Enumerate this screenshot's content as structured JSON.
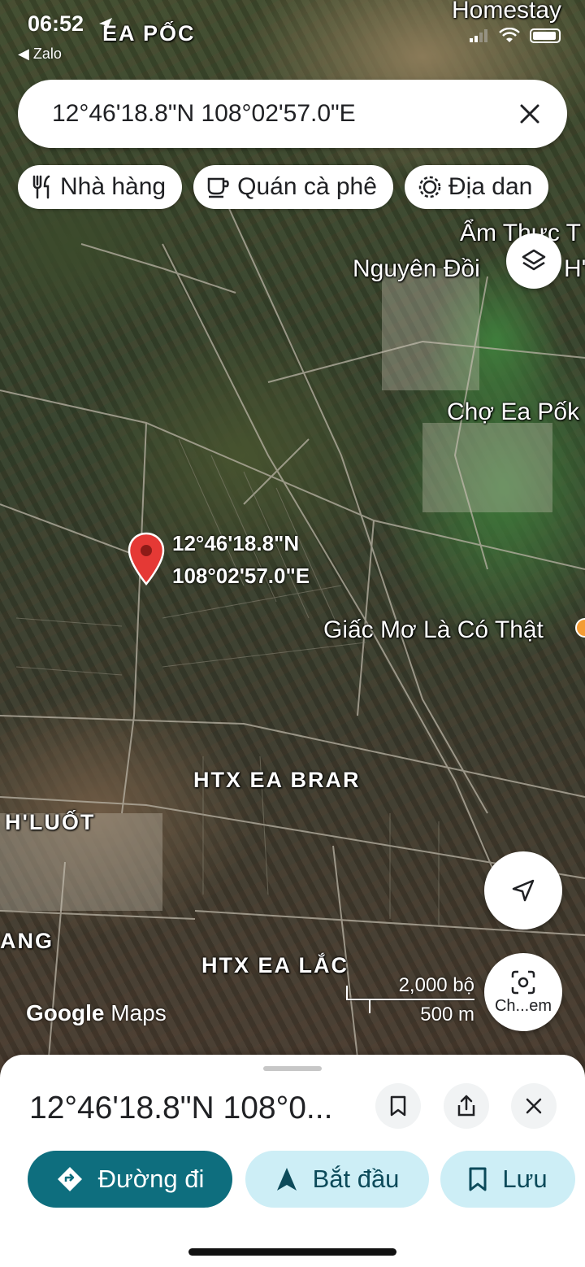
{
  "status_bar": {
    "time": "06:52",
    "back_label": "Zalo"
  },
  "search": {
    "query": "12°46'18.8\"N 108°02'57.0\"E"
  },
  "chips": [
    {
      "label": "Nhà hàng",
      "icon": "restaurant-icon"
    },
    {
      "label": "Quán cà phê",
      "icon": "coffee-icon"
    },
    {
      "label": "Địa dan",
      "icon": "landmark-icon"
    }
  ],
  "map": {
    "labels": {
      "ea_poc": "EA PỐC",
      "homestay": "Homestay",
      "am_thuc": "Ẩm Thực T",
      "nguyen_doi": "Nguyên Đồi",
      "nguyen_doi_tail": "H'la",
      "cho_ea_pok": "Chợ Ea Pốk",
      "giac_mo": "Giấc Mơ Là Có Thật",
      "htx_ea_brar": "HTX EA BRAR",
      "h_luot": "H'LUỐT",
      "ang": "ANG",
      "htx_ea_lac": "HTX EA LẮC"
    },
    "pin_label_line1": "12°46'18.8\"N",
    "pin_label_line2": "108°02'57.0\"E",
    "scale_feet": "2,000 bộ",
    "scale_meters": "500 m",
    "logo_google": "Google",
    "logo_maps": "Maps",
    "photo_search_label": "Ch...em"
  },
  "sheet": {
    "title": "12°46'18.8\"N 108°0...",
    "directions_label": "Đường đi",
    "start_label": "Bắt đầu",
    "save_label": "Lưu"
  },
  "colors": {
    "accent": "#0e6e7e",
    "pin": "#e53935",
    "tonal_button": "#cdeef6"
  }
}
